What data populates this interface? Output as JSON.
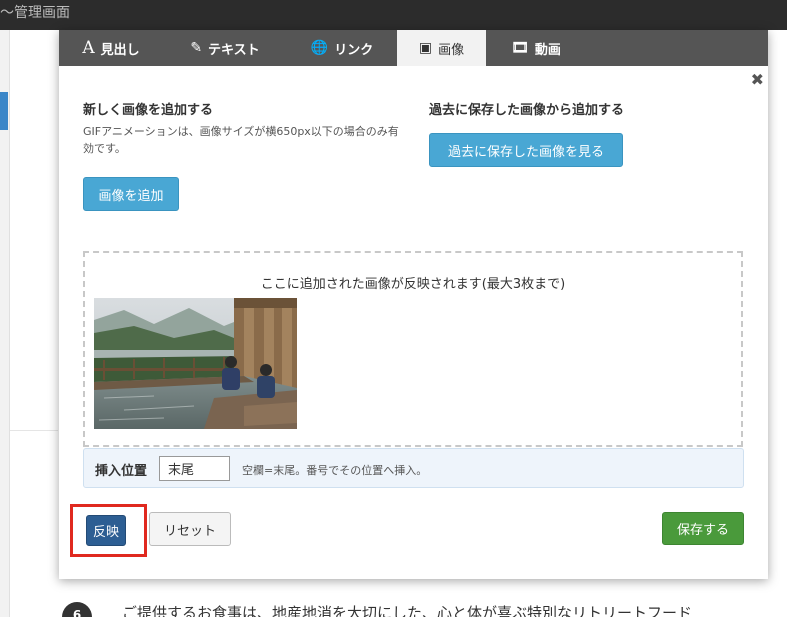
{
  "app": {
    "title": "〜管理画面"
  },
  "tabs": [
    {
      "label": "見出し",
      "icon": "A"
    },
    {
      "label": "テキスト",
      "icon": "✎"
    },
    {
      "label": "リンク",
      "icon": "🌐"
    },
    {
      "label": "画像",
      "icon": "▣"
    },
    {
      "label": "動画",
      "icon": "🎞"
    }
  ],
  "active_tab": "画像",
  "close_icon": "✖",
  "upload": {
    "title": "新しく画像を追加する",
    "note": "GIFアニメーションは、画像サイズが横650px以下の場合のみ有効です。",
    "add_button": "画像を追加"
  },
  "history": {
    "title": "過去に保存した画像から追加する",
    "view_button": "過去に保存した画像を見る"
  },
  "dropzone": {
    "text": "ここに追加された画像が反映されます(最大3枚まで)"
  },
  "insert_position": {
    "label": "挿入位置",
    "value": "末尾",
    "hint": "空欄=末尾。番号でその位置へ挿入。"
  },
  "actions": {
    "reflect": "反映",
    "reset": "リセット",
    "save": "保存する"
  },
  "background": {
    "item_number": "6",
    "item_text": "ご提供するお食事は、地産地消を大切にした、心と体が喜ぶ特別なリトリートフード"
  }
}
